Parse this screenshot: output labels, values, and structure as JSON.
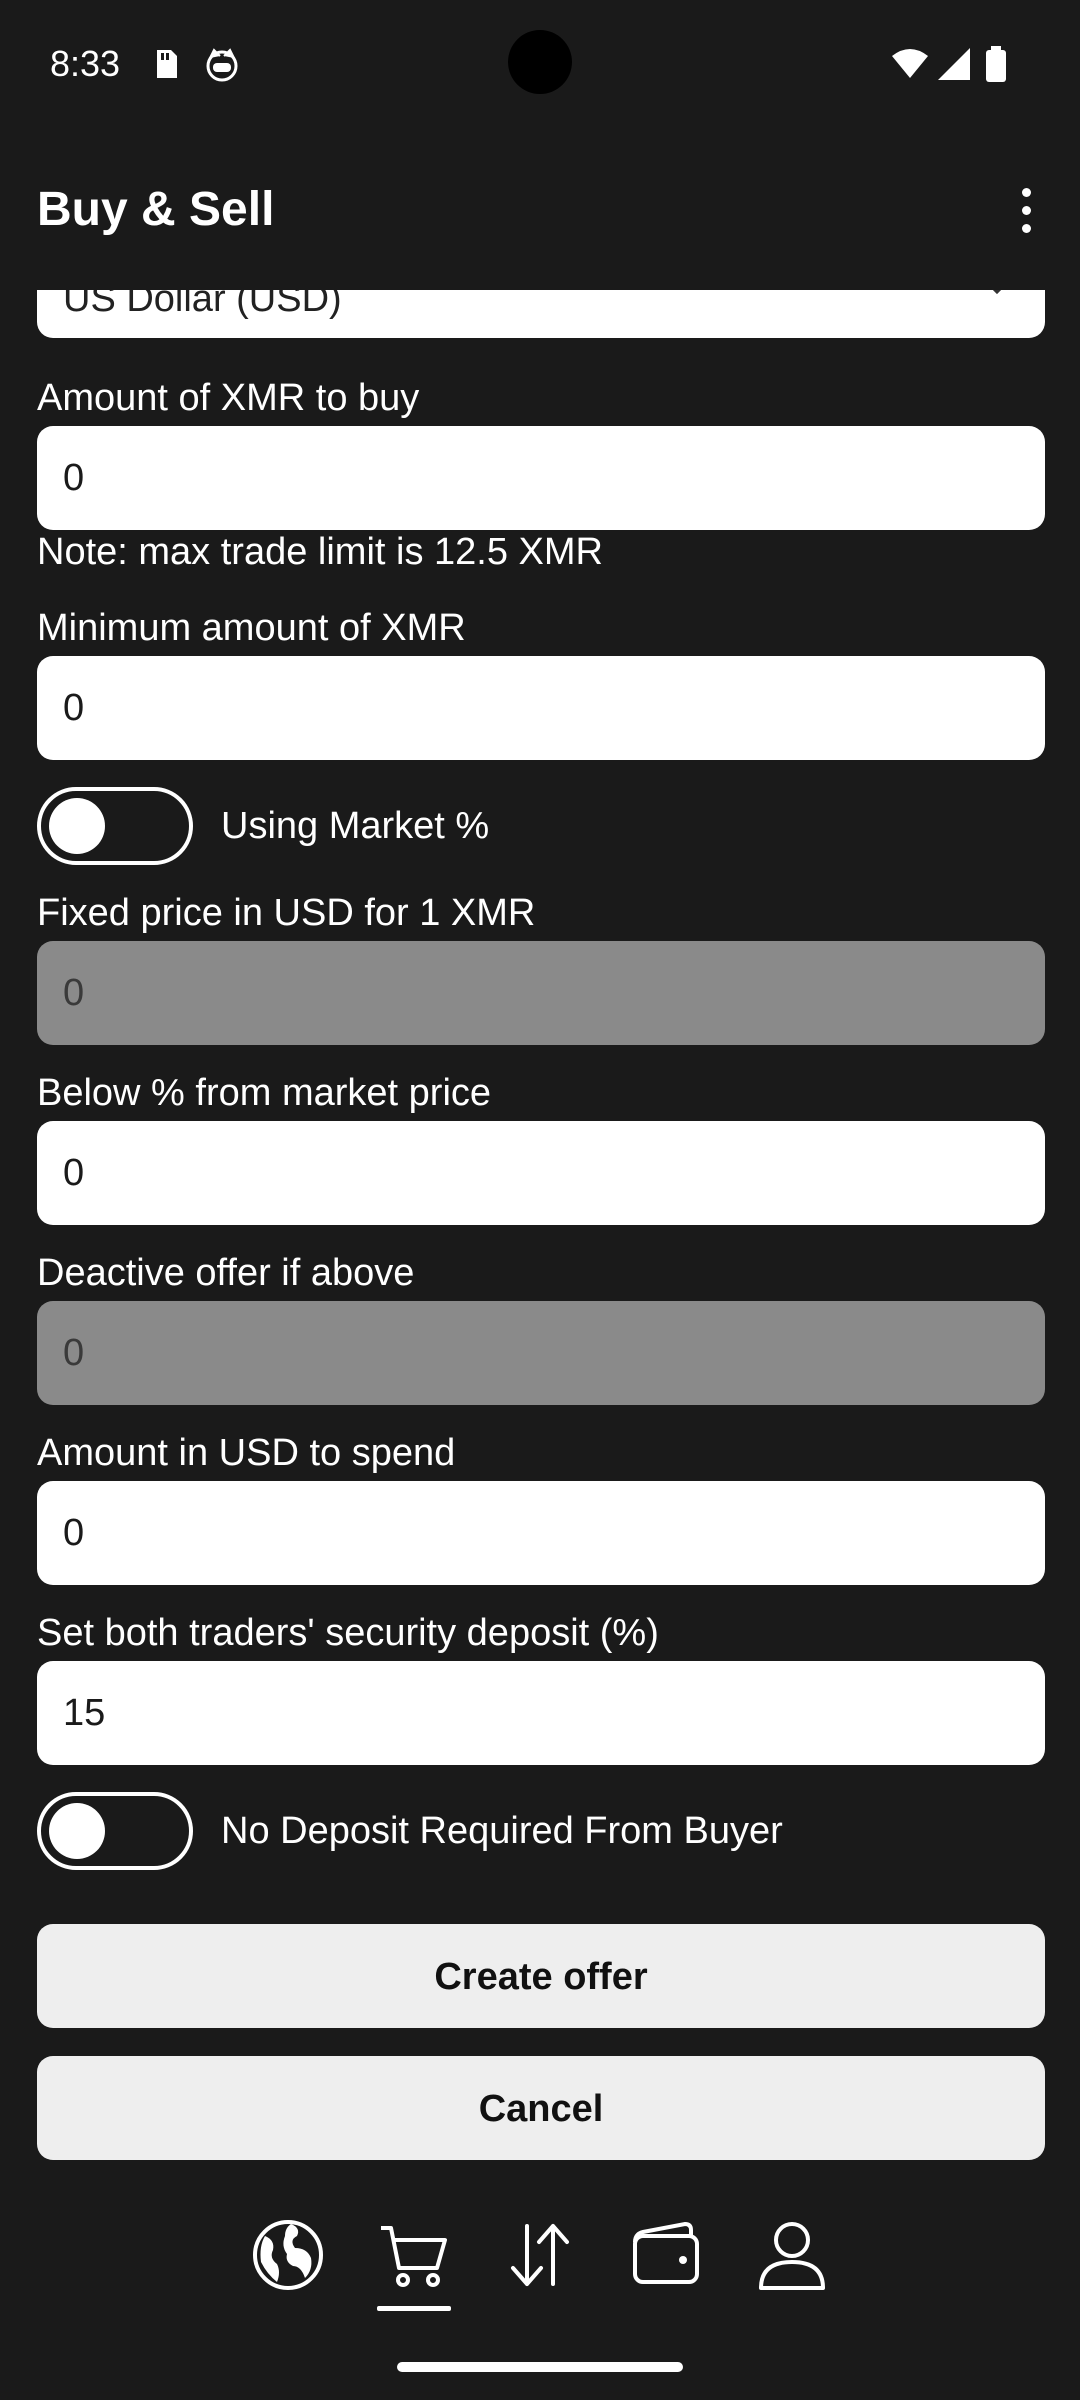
{
  "status_bar": {
    "time": "8:33",
    "icons": [
      "sd-card-icon",
      "cat-face-icon",
      "wifi-icon",
      "signal-icon",
      "battery-icon"
    ]
  },
  "app_bar": {
    "title": "Buy & Sell",
    "menu_icon": "more-vert-icon"
  },
  "form": {
    "currency": {
      "value": "US Dollar (USD)",
      "icon": "chevron-down-icon"
    },
    "amount_to_buy": {
      "label": "Amount of XMR to buy",
      "value": "0"
    },
    "trade_limit_note": "Note: max trade limit is 12.5 XMR",
    "minimum_amount": {
      "label": "Minimum amount of XMR",
      "value": "0"
    },
    "market_toggle": {
      "label": "Using Market %",
      "on": false
    },
    "fixed_price": {
      "label": "Fixed price in USD for 1 XMR",
      "value": "0",
      "disabled": true
    },
    "below_market": {
      "label": "Below % from market price",
      "value": "0"
    },
    "deactivate_above": {
      "label": "Deactive offer if above",
      "value": "0",
      "disabled": true
    },
    "amount_to_spend": {
      "label": "Amount in USD to spend",
      "value": "0"
    },
    "security_deposit": {
      "label": "Set both traders' security deposit (%)",
      "value": "15"
    },
    "no_deposit_toggle": {
      "label": "No Deposit Required From Buyer",
      "on": false
    },
    "create_button": "Create offer",
    "cancel_button": "Cancel"
  },
  "bottom_nav": {
    "items": [
      {
        "icon": "globe-icon",
        "active": false
      },
      {
        "icon": "cart-icon",
        "active": true
      },
      {
        "icon": "swap-arrows-icon",
        "active": false
      },
      {
        "icon": "wallet-icon",
        "active": false
      },
      {
        "icon": "person-icon",
        "active": false
      }
    ]
  },
  "colors": {
    "background": "#1a1a1a",
    "input_background": "#ffffff",
    "input_disabled": "#8a8a8a",
    "button_background": "#eeeeee",
    "text": "#ffffff"
  }
}
